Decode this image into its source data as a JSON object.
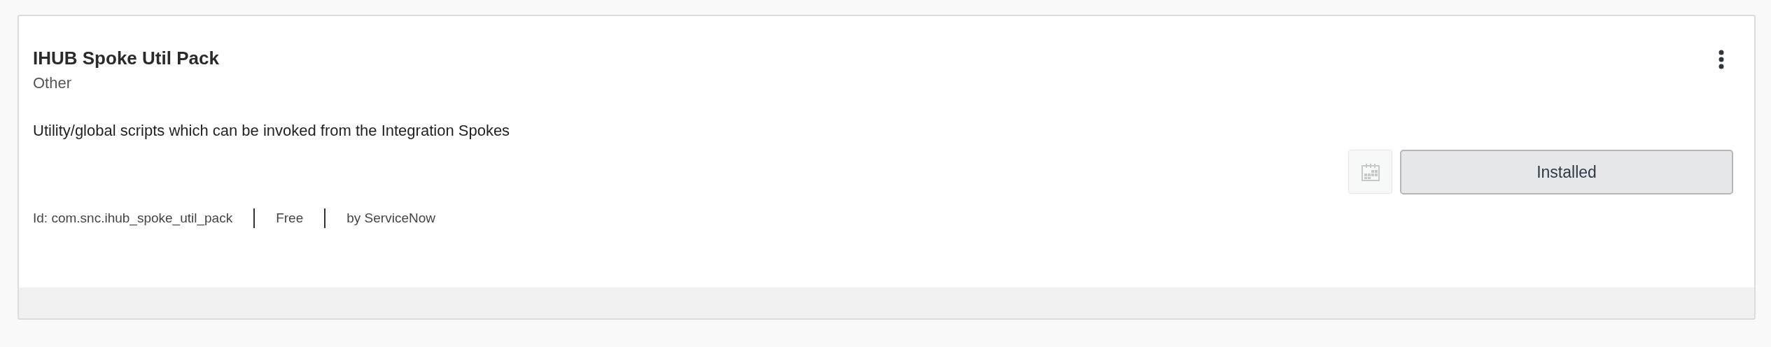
{
  "card": {
    "title": "IHUB Spoke Util Pack",
    "category": "Other",
    "description": "Utility/global scripts which can be invoked from the Integration Spokes",
    "schedule_button": {
      "disabled": true
    },
    "status_button": {
      "label": "Installed"
    },
    "meta": [
      "Id: com.snc.ihub_spoke_util_pack",
      "Free",
      "by ServiceNow"
    ]
  }
}
